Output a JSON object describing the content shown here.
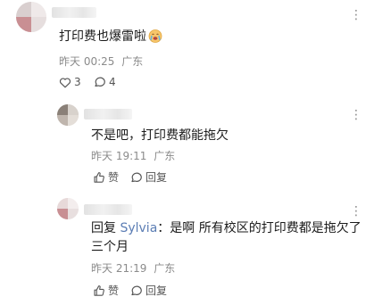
{
  "colors": {
    "text": "#1b1b1b",
    "meta": "#8b8b8b",
    "mention": "#5b7db4",
    "background": "#ffffff"
  },
  "main_comment": {
    "more_label": "⋮",
    "text": "打印费也爆雷啦",
    "emoji": "crying-face-emoji",
    "time": "昨天 00:25",
    "location": "广东",
    "likes": "3",
    "replies": "4"
  },
  "reply1": {
    "more_label": "⋮",
    "text": "不是吧，打印费都能拖欠",
    "time": "昨天 19:11",
    "location": "广东",
    "like_label": "赞",
    "reply_label": "回复"
  },
  "reply2": {
    "more_label": "⋮",
    "reply_prefix": "回复 ",
    "mention": "Sylvia",
    "text_line1": "：是啊 所有校区的打印费都是拖欠了",
    "text_line2": "三个月",
    "time": "昨天 21:19",
    "location": "广东",
    "like_label": "赞",
    "reply_label": "回复"
  }
}
